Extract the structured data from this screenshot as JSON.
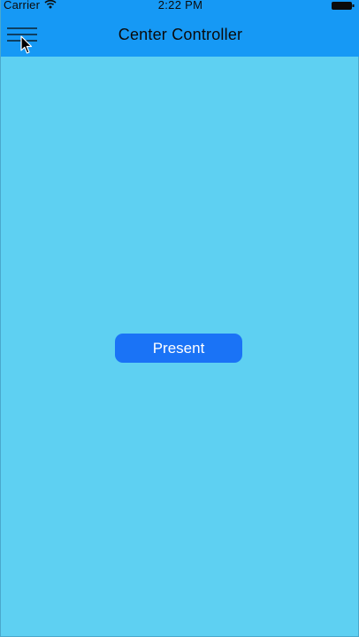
{
  "status_bar": {
    "carrier": "Carrier",
    "time": "2:22 PM",
    "wifi_icon": "wifi-icon",
    "battery_icon": "battery-icon"
  },
  "nav_bar": {
    "title": "Center Controller",
    "menu_icon": "hamburger-menu-icon"
  },
  "main": {
    "present_label": "Present"
  },
  "colors": {
    "nav_background": "#1699f5",
    "content_background": "#5ed0f2",
    "button_background": "#1a73f6",
    "button_text": "#ffffff"
  }
}
